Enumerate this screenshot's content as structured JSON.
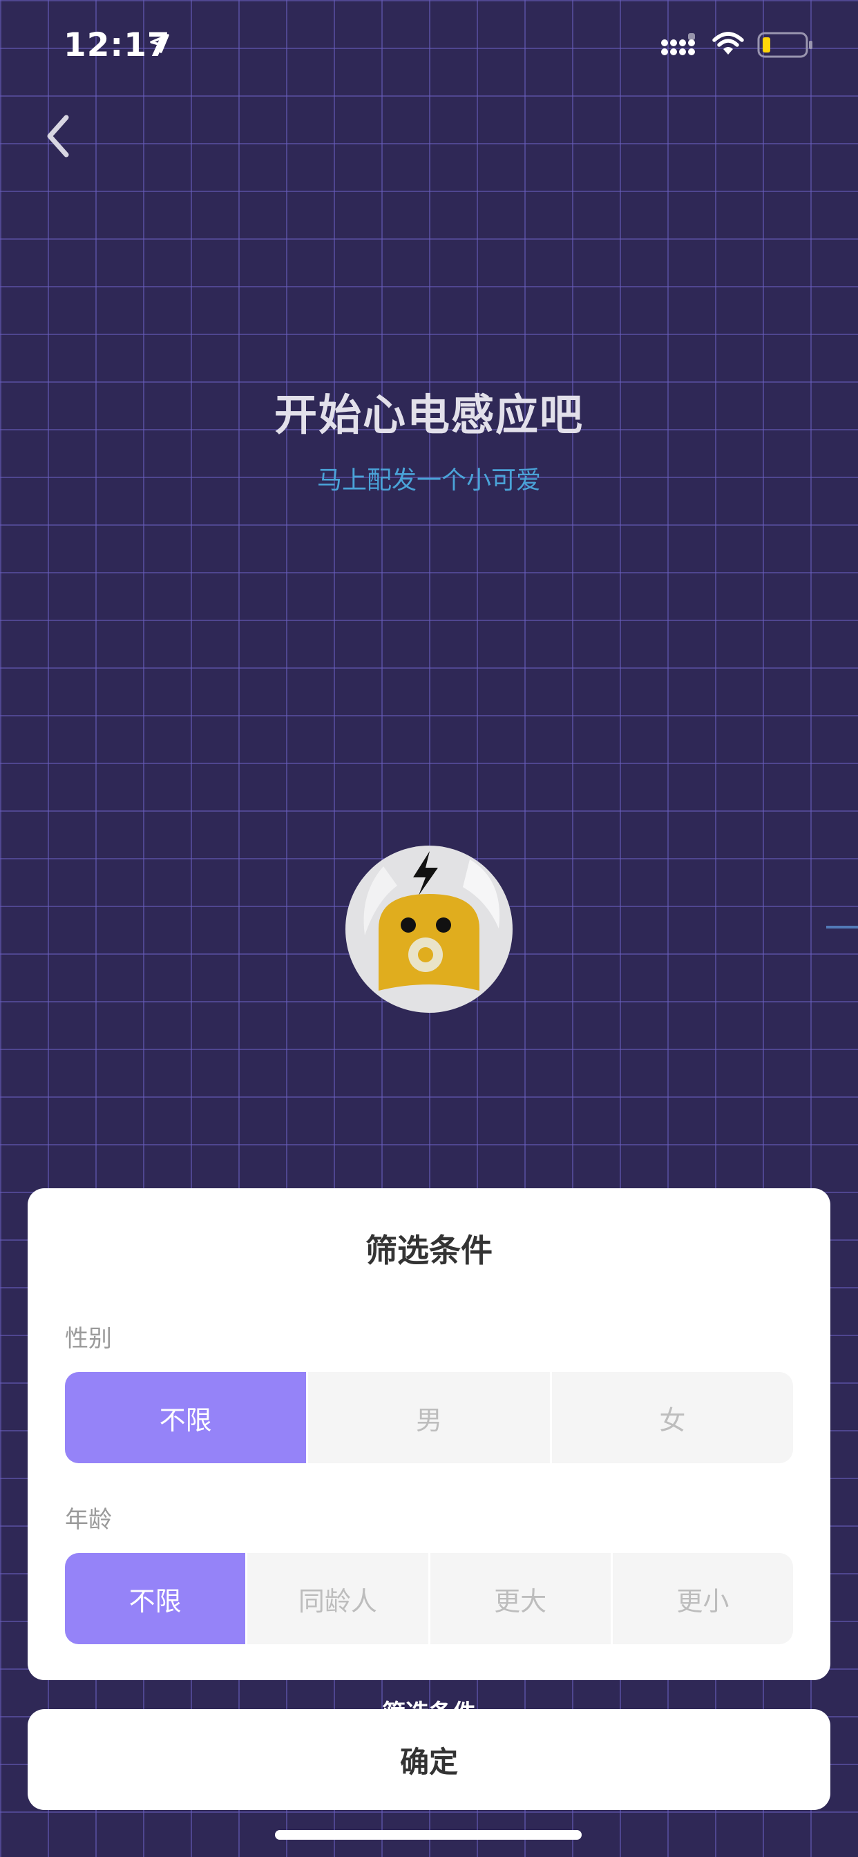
{
  "status_bar": {
    "time": "12:17"
  },
  "hero": {
    "title": "开始心电感应吧",
    "subtitle": "马上配发一个小可爱"
  },
  "filter": {
    "title": "筛选条件",
    "gender": {
      "label": "性别",
      "options": [
        "不限",
        "男",
        "女"
      ],
      "selected": "不限"
    },
    "age": {
      "label": "年龄",
      "options": [
        "不限",
        "同龄人",
        "更大",
        "更小"
      ],
      "selected": "不限"
    },
    "peek_label": "筛选条件"
  },
  "confirm_label": "确定",
  "colors": {
    "background": "#2f2856",
    "grid": "#6a5ebe",
    "accent": "#9583f8",
    "subtitle": "#4aa3d8",
    "avatar_yellow": "#e0ad1e"
  },
  "icons": [
    "location-arrow-icon",
    "signal-icon",
    "wifi-icon",
    "battery-icon",
    "back-chevron-icon",
    "lightning-icon"
  ]
}
